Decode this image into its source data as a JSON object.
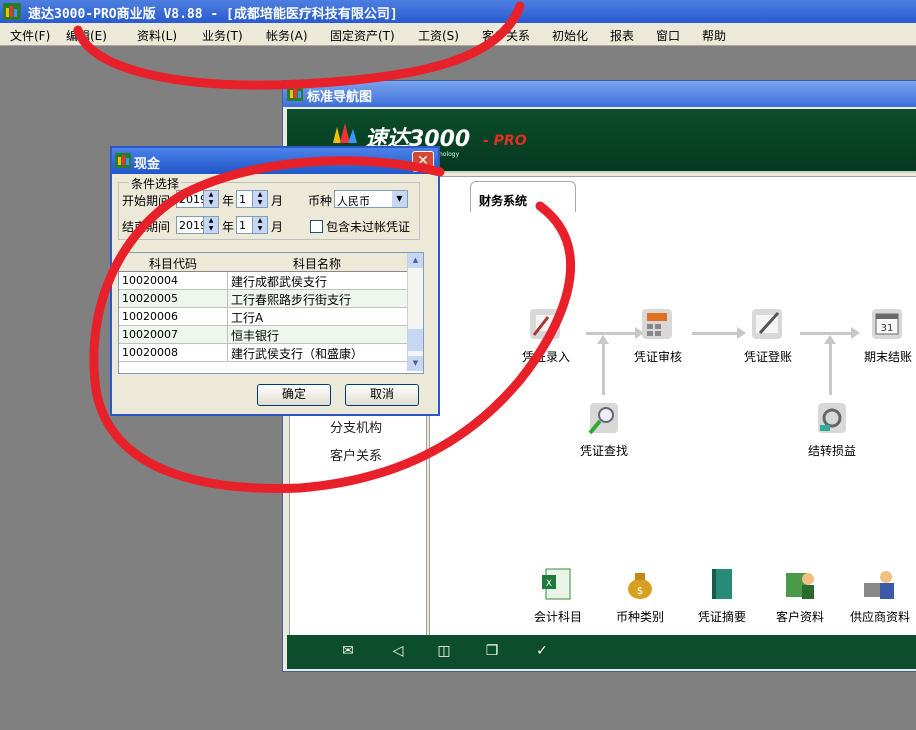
{
  "app": {
    "title": "速达3000-PRO商业版  V8.88 - [成都培能医疗科技有限公司]"
  },
  "menu": [
    "文件(F)",
    "编辑(E)",
    "资料(L)",
    "业务(T)",
    "帐务(A)",
    "固定资产(T)",
    "工资(S)",
    "客户关系",
    "初始化",
    "报表",
    "窗口",
    "帮助"
  ],
  "navigator": {
    "title": "标准导航图",
    "brand": "速达3000",
    "brand_suffix": "- PRO",
    "brand_tag": "nology",
    "tab_label": "财务系统",
    "left_links": [
      "分支机构",
      "客户关系"
    ],
    "flow_nodes": [
      "凭证录入",
      "凭证审核",
      "凭证登账",
      "期末结账",
      "凭证查找",
      "结转损益"
    ],
    "bottom_items": [
      "会计科目",
      "币种类别",
      "凭证摘要",
      "客户资料",
      "供应商资料"
    ],
    "calendar_day": "31"
  },
  "dialog": {
    "title": "现金",
    "group_label": "条件选择",
    "start_label": "开始期间",
    "end_label": "结束期间",
    "start_year": "2019",
    "start_month": "1",
    "end_year": "2019",
    "end_month": "1",
    "year_unit": "年",
    "month_unit": "月",
    "currency_label": "币种",
    "currency_value": "人民币",
    "include_unposted_label": "包含未过帐凭证",
    "include_unposted_checked": false,
    "columns": [
      "科目代码",
      "科目名称"
    ],
    "rows": [
      {
        "code": "10020004",
        "name": "建行成都武侯支行"
      },
      {
        "code": "10020005",
        "name": "工行春熙路步行街支行"
      },
      {
        "code": "10020006",
        "name": "工行A"
      },
      {
        "code": "10020007",
        "name": "恒丰银行"
      },
      {
        "code": "10020008",
        "name": "建行武侯支行（和盛康）"
      }
    ],
    "ok_label": "确定",
    "cancel_label": "取消"
  },
  "colors": {
    "titlebar": "#2a5bd0",
    "banner": "#0b4d2c",
    "annotation": "#e8202a"
  }
}
